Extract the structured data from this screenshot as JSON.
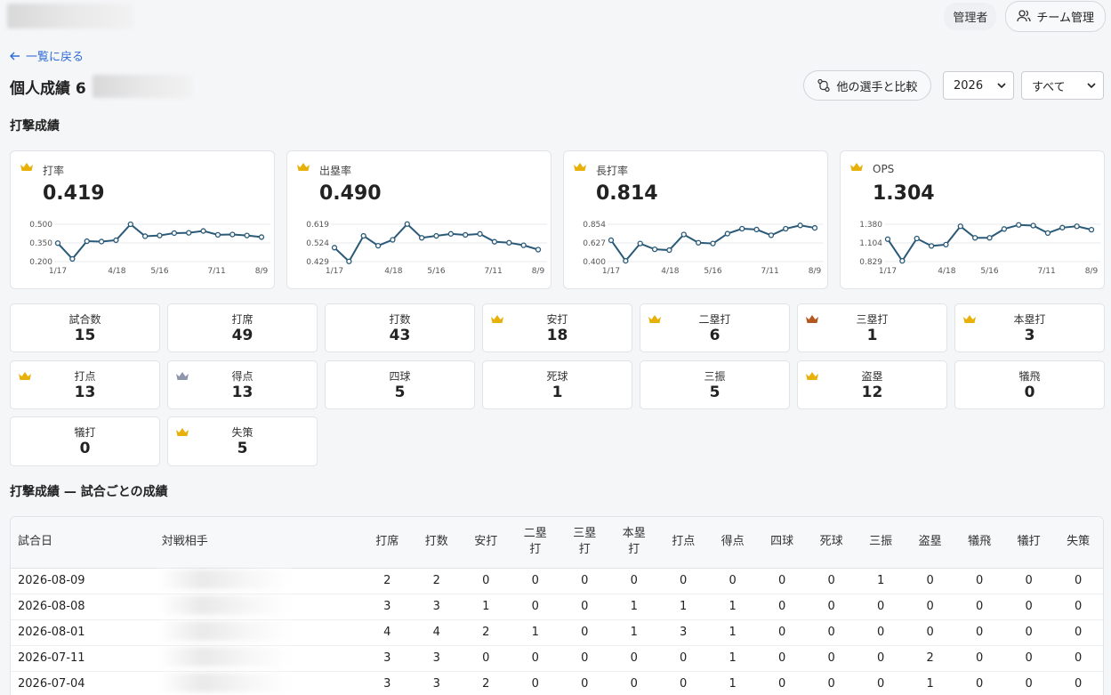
{
  "header": {
    "role": "管理者",
    "team_button": "チーム管理"
  },
  "nav": {
    "back": "一覧に戻る"
  },
  "page": {
    "title_prefix": "個人成績 6 ",
    "compare_button": "他の選手と比較",
    "year": "2026",
    "filter": "すべて"
  },
  "sections": {
    "batting": "打撃成績",
    "by_game": "打撃成績 — 試合ごとの成績"
  },
  "colors": {
    "gold": "#e8b10a",
    "silver": "#8e97ab",
    "bronze": "#b5581f",
    "line": "#2a5a78"
  },
  "kpis": [
    {
      "label": "打率",
      "value": "0.419",
      "crown": "gold",
      "chart_data": {
        "type": "line",
        "ylim": [
          0.2,
          0.5
        ],
        "yticks": [
          "0.500",
          "0.350",
          "0.200"
        ],
        "xticks": [
          "1/17",
          "4/18",
          "5/16",
          "7/11",
          "8/9"
        ],
        "values": [
          0.348,
          0.222,
          0.364,
          0.361,
          0.372,
          0.5,
          0.404,
          0.41,
          0.429,
          0.431,
          0.446,
          0.415,
          0.418,
          0.41,
          0.397
        ]
      }
    },
    {
      "label": "出塁率",
      "value": "0.490",
      "crown": "gold",
      "chart_data": {
        "type": "line",
        "ylim": [
          0.429,
          0.619
        ],
        "yticks": [
          "0.619",
          "0.524",
          "0.429"
        ],
        "xticks": [
          "1/17",
          "4/18",
          "5/16",
          "7/11",
          "8/9"
        ],
        "values": [
          0.5,
          0.43,
          0.56,
          0.51,
          0.54,
          0.62,
          0.55,
          0.56,
          0.57,
          0.565,
          0.57,
          0.53,
          0.525,
          0.512,
          0.49
        ]
      }
    },
    {
      "label": "長打率",
      "value": "0.814",
      "crown": "gold",
      "chart_data": {
        "type": "line",
        "ylim": [
          0.4,
          0.854
        ],
        "yticks": [
          "0.854",
          "0.627",
          "0.400"
        ],
        "xticks": [
          "1/17",
          "4/18",
          "5/16",
          "7/11",
          "8/9"
        ],
        "values": [
          0.66,
          0.41,
          0.62,
          0.55,
          0.54,
          0.73,
          0.63,
          0.62,
          0.74,
          0.8,
          0.79,
          0.72,
          0.8,
          0.84,
          0.81
        ]
      }
    },
    {
      "label": "OPS",
      "value": "1.304",
      "crown": "gold",
      "chart_data": {
        "type": "line",
        "ylim": [
          0.829,
          1.38
        ],
        "yticks": [
          "1.380",
          "1.104",
          "0.829"
        ],
        "xticks": [
          "1/17",
          "4/18",
          "5/16",
          "7/11",
          "8/9"
        ],
        "values": [
          1.16,
          0.84,
          1.17,
          1.06,
          1.08,
          1.35,
          1.18,
          1.18,
          1.31,
          1.37,
          1.36,
          1.25,
          1.33,
          1.35,
          1.3
        ]
      }
    }
  ],
  "stats": [
    {
      "label": "試合数",
      "value": "15",
      "crown": ""
    },
    {
      "label": "打席",
      "value": "49",
      "crown": ""
    },
    {
      "label": "打数",
      "value": "43",
      "crown": ""
    },
    {
      "label": "安打",
      "value": "18",
      "crown": "gold"
    },
    {
      "label": "二塁打",
      "value": "6",
      "crown": "gold"
    },
    {
      "label": "三塁打",
      "value": "1",
      "crown": "bronze"
    },
    {
      "label": "本塁打",
      "value": "3",
      "crown": "gold"
    },
    {
      "label": "打点",
      "value": "13",
      "crown": "gold"
    },
    {
      "label": "得点",
      "value": "13",
      "crown": "silver"
    },
    {
      "label": "四球",
      "value": "5",
      "crown": ""
    },
    {
      "label": "死球",
      "value": "1",
      "crown": ""
    },
    {
      "label": "三振",
      "value": "5",
      "crown": ""
    },
    {
      "label": "盗塁",
      "value": "12",
      "crown": "gold"
    },
    {
      "label": "犠飛",
      "value": "0",
      "crown": ""
    },
    {
      "label": "犠打",
      "value": "0",
      "crown": ""
    },
    {
      "label": "失策",
      "value": "5",
      "crown": "gold"
    }
  ],
  "table": {
    "headers": [
      "試合日",
      "対戦相手",
      "打席",
      "打数",
      "安打",
      "二塁打",
      "三塁打",
      "本塁打",
      "打点",
      "得点",
      "四球",
      "死球",
      "三振",
      "盗塁",
      "犠飛",
      "犠打",
      "失策"
    ],
    "rows": [
      [
        "2026-08-09",
        "",
        "2",
        "2",
        "0",
        "0",
        "0",
        "0",
        "0",
        "0",
        "0",
        "0",
        "1",
        "0",
        "0",
        "0",
        "0"
      ],
      [
        "2026-08-08",
        "",
        "3",
        "3",
        "1",
        "0",
        "0",
        "1",
        "1",
        "1",
        "0",
        "0",
        "0",
        "0",
        "0",
        "0",
        "0"
      ],
      [
        "2026-08-01",
        "",
        "4",
        "4",
        "2",
        "1",
        "0",
        "1",
        "3",
        "1",
        "0",
        "0",
        "0",
        "0",
        "0",
        "0",
        "0"
      ],
      [
        "2026-07-11",
        "",
        "3",
        "3",
        "0",
        "0",
        "0",
        "0",
        "0",
        "1",
        "0",
        "0",
        "0",
        "2",
        "0",
        "0",
        "0"
      ],
      [
        "2026-07-04",
        "",
        "3",
        "3",
        "2",
        "0",
        "0",
        "0",
        "0",
        "1",
        "0",
        "0",
        "0",
        "1",
        "0",
        "0",
        "0"
      ]
    ]
  }
}
